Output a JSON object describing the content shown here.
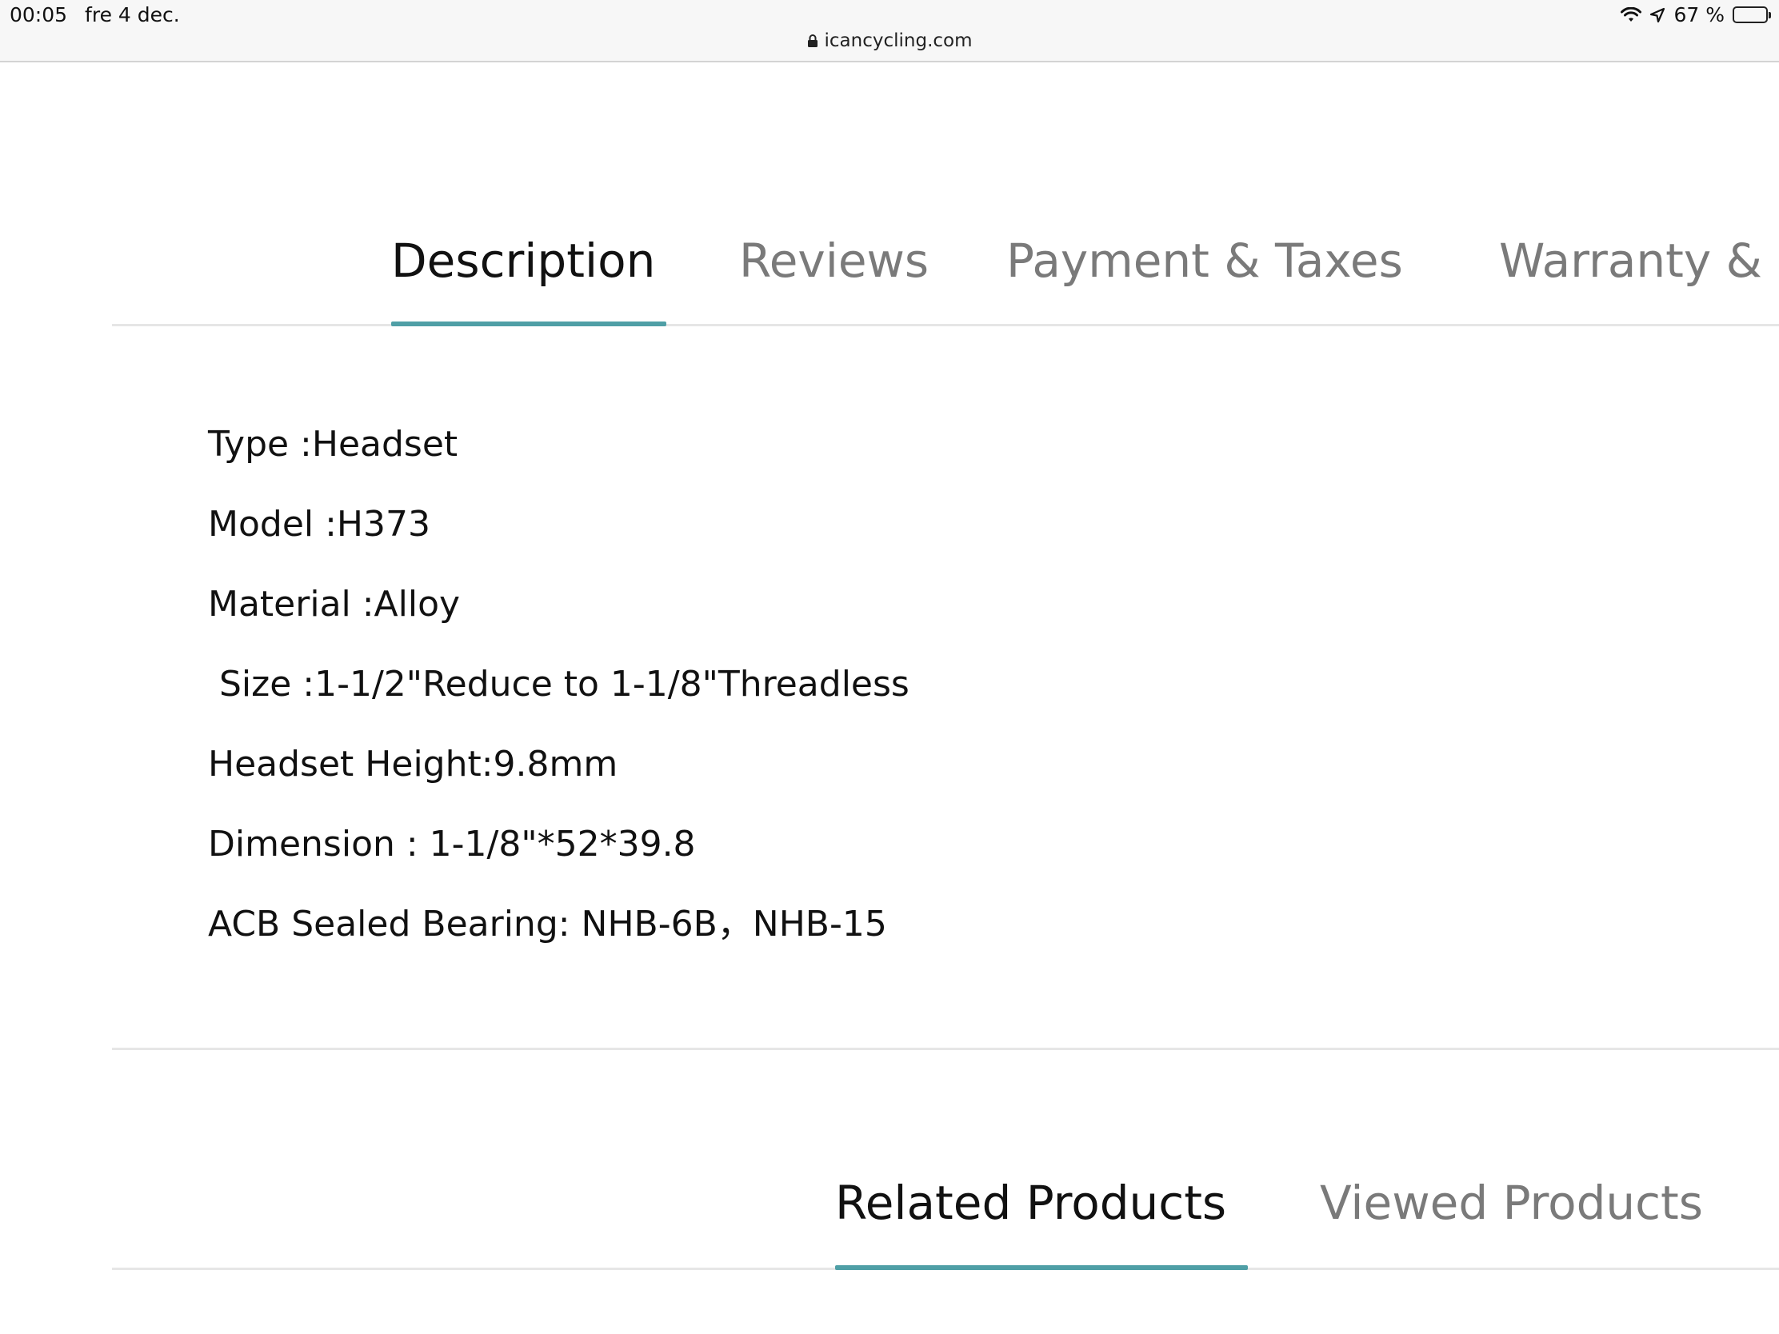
{
  "status_bar": {
    "time": "00:05",
    "date": "fre 4 dec.",
    "battery_text": "67 %",
    "battery_level": 0.67,
    "icons": [
      "wifi-icon",
      "location-icon",
      "battery-icon"
    ]
  },
  "browser": {
    "url": "icancycling.com",
    "lock_icon": "lock-icon"
  },
  "tabs": [
    {
      "label": "Description",
      "active": true
    },
    {
      "label": "Reviews",
      "active": false
    },
    {
      "label": "Payment & Taxes",
      "active": false
    },
    {
      "label": "Warranty &",
      "active": false
    }
  ],
  "specs": [
    "Type :Headset",
    "Model :H373",
    "Material :Alloy",
    " Size :1-1/2\"Reduce to 1-1/8\"Threadless",
    "Headset Height:9.8mm",
    "Dimension : 1-1/8\"*52*39.8",
    "ACB Sealed Bearing: NHB-6B，NHB-15"
  ],
  "related_tabs": [
    {
      "label": "Related Products",
      "active": true
    },
    {
      "label": "Viewed Products",
      "active": false
    }
  ],
  "colors": {
    "accent": "#4f9fa6",
    "inactive_tab": "#7a7a7a",
    "active_tab": "#111111",
    "divider": "#e6e6e6"
  }
}
